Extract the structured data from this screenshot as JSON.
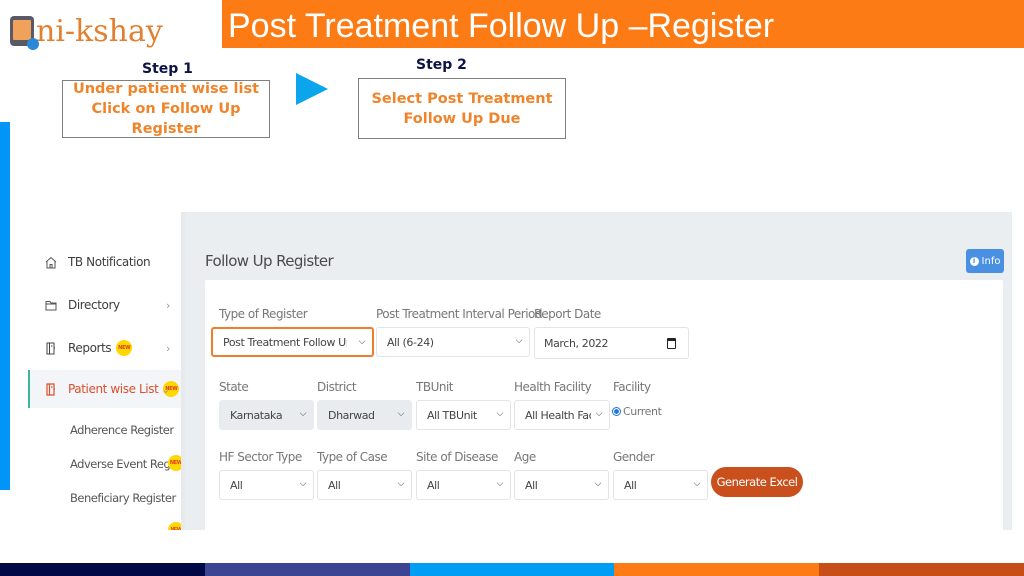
{
  "logo": {
    "text": "ni-kshay"
  },
  "header": {
    "title": "Post Treatment Follow Up –Register"
  },
  "steps": [
    {
      "label": "Step 1",
      "instruction": "Under patient wise list Click on Follow Up Register"
    },
    {
      "label": "Step 2",
      "instruction": "Select Post Treatment Follow Up Due"
    }
  ],
  "sidebar": {
    "items": [
      {
        "label": "TB Notification",
        "icon": "home-icon",
        "new": false,
        "chevron": ""
      },
      {
        "label": "Directory",
        "icon": "folder-icon",
        "new": false,
        "chevron": "›"
      },
      {
        "label": "Reports",
        "icon": "report-icon",
        "new": true,
        "chevron": "›"
      },
      {
        "label": "Patient wise List",
        "icon": "list-icon",
        "new": true,
        "chevron": "⌄",
        "active": true
      }
    ],
    "sub_items": [
      {
        "label": "Adherence Register",
        "new": false
      },
      {
        "label": "Adverse Event Register",
        "new": true
      },
      {
        "label": "Beneficiary Register",
        "new": false
      }
    ],
    "new_badge_text": "NEW"
  },
  "main": {
    "page_title": "Follow Up Register",
    "info_button": {
      "label": "Info",
      "icon_glyph": "i"
    },
    "filters": {
      "type_of_register": {
        "label": "Type of Register",
        "value": "Post Treatment Follow Up Due"
      },
      "interval_period": {
        "label": "Post Treatment Interval Period",
        "value": "All (6-24)"
      },
      "report_date": {
        "label": "Report Date",
        "value": "March, 2022"
      },
      "state": {
        "label": "State",
        "value": "Karnataka"
      },
      "district": {
        "label": "District",
        "value": "Dharwad"
      },
      "tbunit": {
        "label": "TBUnit",
        "value": "All TBUnit"
      },
      "health_facility": {
        "label": "Health Facility",
        "value": "All Health Facil"
      },
      "facility": {
        "label": "Facility",
        "radio_label": "Current",
        "selected": true
      },
      "hf_sector_type": {
        "label": "HF Sector Type",
        "value": "All"
      },
      "type_of_case": {
        "label": "Type of Case",
        "value": "All"
      },
      "site_of_disease": {
        "label": "Site of Disease",
        "value": "All"
      },
      "age": {
        "label": "Age",
        "value": "All"
      },
      "gender": {
        "label": "Gender",
        "value": "All"
      }
    },
    "generate_button": "Generate Excel"
  },
  "caret_glyph": "⌵",
  "colors": {
    "banner": "#fc7b14",
    "step_text": "#f0842a",
    "arrow": "#0aa5ea",
    "left_strip": "#0095f6",
    "generate_button": "#c9501c",
    "highlight_border": "#ef7d2e",
    "bottom_bar": [
      "#000846",
      "#3b4594",
      "#009df5",
      "#fd7b15",
      "#c84e17"
    ]
  }
}
